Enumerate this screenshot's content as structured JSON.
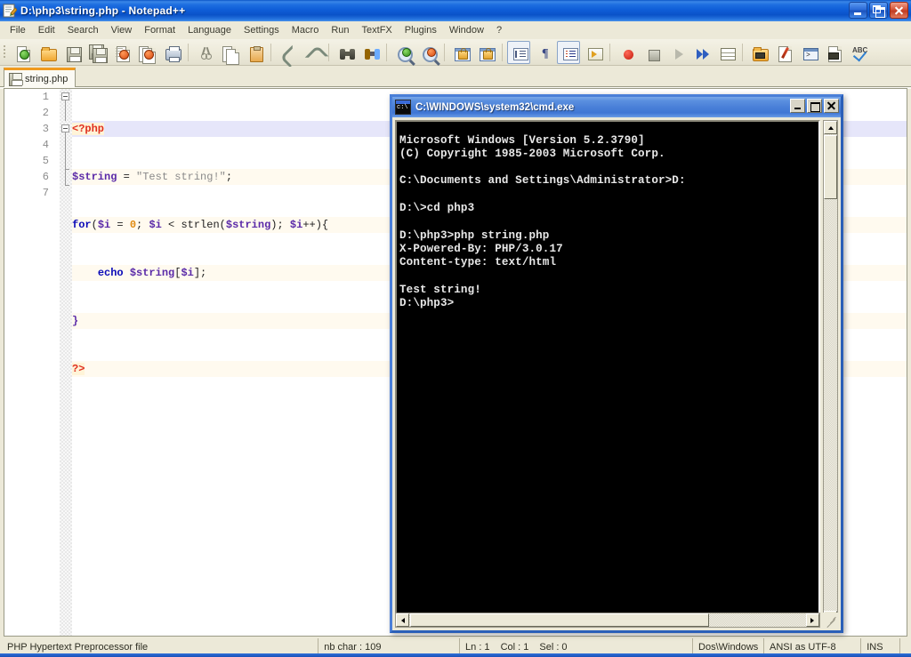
{
  "window": {
    "title": "D:\\php3\\string.php - Notepad++",
    "icon": "notepad-plus-plus-icon",
    "controls": {
      "minimize": "Minimize",
      "restore": "Restore",
      "close": "Close"
    }
  },
  "menu": {
    "items": [
      "File",
      "Edit",
      "Search",
      "View",
      "Format",
      "Language",
      "Settings",
      "Macro",
      "Run",
      "TextFX",
      "Plugins",
      "Window",
      "?"
    ]
  },
  "toolbar": {
    "groups": [
      {
        "buttons": [
          {
            "name": "new-file-icon",
            "label": "New"
          },
          {
            "name": "open-file-icon",
            "label": "Open"
          },
          {
            "name": "save-icon",
            "label": "Save"
          },
          {
            "name": "save-all-icon",
            "label": "Save All"
          },
          {
            "name": "close-file-icon",
            "label": "Close"
          },
          {
            "name": "close-all-icon",
            "label": "Close All"
          },
          {
            "name": "print-icon",
            "label": "Print"
          }
        ]
      },
      {
        "buttons": [
          {
            "name": "cut-icon",
            "label": "Cut"
          },
          {
            "name": "copy-icon",
            "label": "Copy"
          },
          {
            "name": "paste-icon",
            "label": "Paste"
          }
        ]
      },
      {
        "buttons": [
          {
            "name": "undo-icon",
            "label": "Undo"
          },
          {
            "name": "redo-icon",
            "label": "Redo"
          }
        ]
      },
      {
        "buttons": [
          {
            "name": "find-icon",
            "label": "Find"
          },
          {
            "name": "replace-icon",
            "label": "Replace"
          }
        ]
      },
      {
        "buttons": [
          {
            "name": "zoom-in-icon",
            "label": "Zoom In"
          },
          {
            "name": "zoom-out-icon",
            "label": "Zoom Out"
          }
        ]
      },
      {
        "buttons": [
          {
            "name": "sync-vertical-scroll-icon",
            "label": "Synchronize Vertical Scrolling"
          },
          {
            "name": "sync-horizontal-scroll-icon",
            "label": "Synchronize Horizontal Scrolling"
          }
        ]
      },
      {
        "buttons": [
          {
            "name": "word-wrap-icon",
            "label": "Word wrap"
          },
          {
            "name": "show-all-characters-icon",
            "label": "Show All Characters"
          },
          {
            "name": "indent-guide-icon",
            "label": "Show Indent Guide"
          },
          {
            "name": "user-defined-dialog-icon",
            "label": "User Defined Dialogue"
          }
        ]
      },
      {
        "buttons": [
          {
            "name": "record-macro-icon",
            "label": "Start Recording"
          },
          {
            "name": "stop-macro-icon",
            "label": "Stop Recording"
          },
          {
            "name": "play-macro-icon",
            "label": "Playback"
          },
          {
            "name": "run-macro-multiple-icon",
            "label": "Run a Macro Multiple Times"
          },
          {
            "name": "save-macro-icon",
            "label": "Save Current Recorded Macro"
          }
        ]
      },
      {
        "buttons": [
          {
            "name": "folder-as-workspace-icon",
            "label": "Folder as Workspace"
          },
          {
            "name": "pen-tool-icon",
            "label": "Document Map"
          },
          {
            "name": "function-list-icon",
            "label": "Function List"
          },
          {
            "name": "document-switcher-icon",
            "label": "Document Switcher"
          },
          {
            "name": "spell-check-icon",
            "label": "Spell Check"
          }
        ]
      }
    ]
  },
  "tabs": [
    {
      "label": "string.php",
      "icon": "saved-file-icon",
      "active": true
    }
  ],
  "editor": {
    "lines": [
      {
        "no": "1",
        "current": true,
        "fold": "open",
        "segments": [
          {
            "text": "<?php",
            "class": "t-tag hl-tag"
          }
        ]
      },
      {
        "no": "2",
        "current": false,
        "fold": "line",
        "segments": [
          {
            "text": "$string",
            "class": "t-var"
          },
          {
            "text": " = ",
            "class": "t-op"
          },
          {
            "text": "\"Test string!\"",
            "class": "t-str"
          },
          {
            "text": ";",
            "class": "t-op"
          }
        ]
      },
      {
        "no": "3",
        "current": false,
        "fold": "open",
        "segments": [
          {
            "text": "for",
            "class": "t-kw"
          },
          {
            "text": "(",
            "class": "t-op"
          },
          {
            "text": "$i",
            "class": "t-var"
          },
          {
            "text": " = ",
            "class": "t-op"
          },
          {
            "text": "0",
            "class": "t-num"
          },
          {
            "text": "; ",
            "class": "t-op"
          },
          {
            "text": "$i",
            "class": "t-var"
          },
          {
            "text": " < ",
            "class": "t-op"
          },
          {
            "text": "strlen",
            "class": "t-fn"
          },
          {
            "text": "(",
            "class": "t-op"
          },
          {
            "text": "$string",
            "class": "t-var"
          },
          {
            "text": "); ",
            "class": "t-op"
          },
          {
            "text": "$i",
            "class": "t-var"
          },
          {
            "text": "++){",
            "class": "t-op"
          }
        ]
      },
      {
        "no": "4",
        "current": false,
        "fold": "line",
        "segments": [
          {
            "text": "    ",
            "class": "t-plain"
          },
          {
            "text": "echo",
            "class": "t-kw"
          },
          {
            "text": " ",
            "class": "t-op"
          },
          {
            "text": "$string",
            "class": "t-var"
          },
          {
            "text": "[",
            "class": "t-op"
          },
          {
            "text": "$i",
            "class": "t-var"
          },
          {
            "text": "];",
            "class": "t-op"
          }
        ]
      },
      {
        "no": "5",
        "current": false,
        "fold": "tick",
        "segments": [
          {
            "text": "}",
            "class": "t-var"
          }
        ]
      },
      {
        "no": "6",
        "current": false,
        "fold": "end",
        "segments": [
          {
            "text": "?>",
            "class": "t-tag hl-tag"
          }
        ]
      },
      {
        "no": "7",
        "current": false,
        "fold": "none",
        "segments": []
      }
    ]
  },
  "console": {
    "title": "C:\\WINDOWS\\system32\\cmd.exe",
    "icon": "cmd-icon",
    "controls": {
      "minimize": "Minimize",
      "maximize": "Maximize",
      "close": "Close"
    },
    "output": "Microsoft Windows [Version 5.2.3790]\n(C) Copyright 1985-2003 Microsoft Corp.\n\nC:\\Documents and Settings\\Administrator>D:\n\nD:\\>cd php3\n\nD:\\php3>php string.php\nX-Powered-By: PHP/3.0.17\nContent-type: text/html\n\nTest string!\nD:\\php3>"
  },
  "status_bar": {
    "file_type": "PHP Hypertext Preprocessor file",
    "char_count": "nb char : 109",
    "line": "Ln : 1",
    "col": "Col : 1",
    "sel": "Sel : 0",
    "eol": "Dos\\Windows",
    "encoding": "ANSI as UTF-8",
    "insert_mode": "INS"
  },
  "colors": {
    "title_bar": "#1d6ee0",
    "chrome": "#ece9d8",
    "tab_accent": "#f09a1e",
    "console_bg": "#000000",
    "console_fg": "#e8e8e8",
    "current_line": "#e6e6fa",
    "php_block_bg": "#fffaef"
  }
}
